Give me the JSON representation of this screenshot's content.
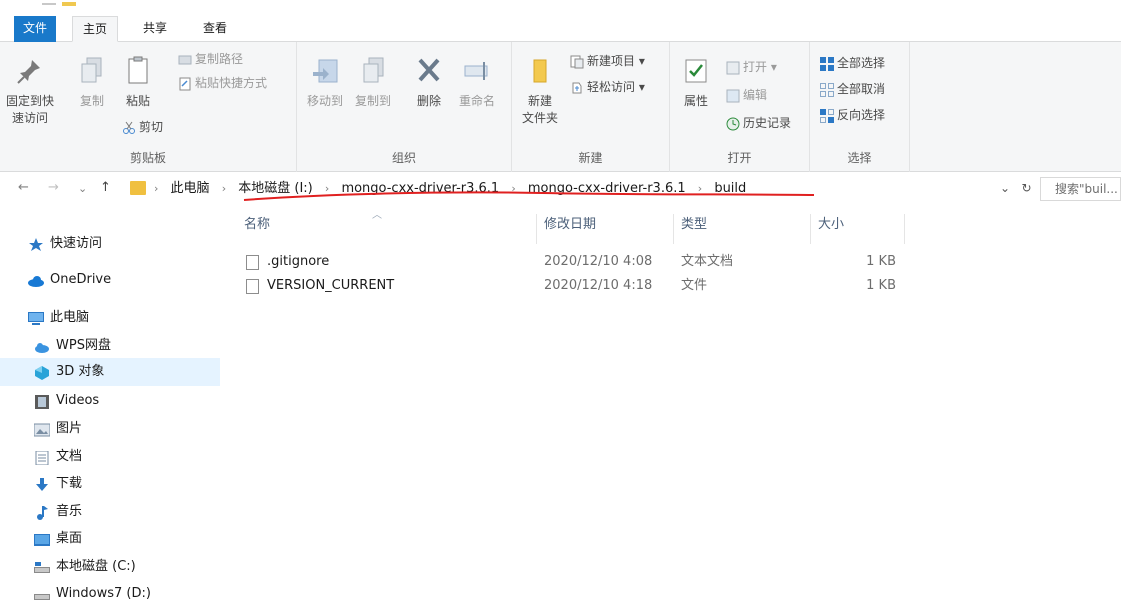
{
  "ribbon_tabs": {
    "file": "文件",
    "home": "主页",
    "share": "共享",
    "view": "查看"
  },
  "clipboard": {
    "pin_label_1": "固定到快",
    "pin_label_2": "速访问",
    "copy": "复制",
    "paste": "粘贴",
    "copy_path": "复制路径",
    "paste_shortcut": "粘贴快捷方式",
    "cut": "剪切",
    "group": "剪贴板"
  },
  "organize": {
    "move_to": "移动到",
    "copy_to": "复制到",
    "delete": "删除",
    "rename": "重命名",
    "group": "组织"
  },
  "new": {
    "new_folder_1": "新建",
    "new_folder_2": "文件夹",
    "new_item": "新建项目 ▾",
    "easy_access": "轻松访问 ▾",
    "group": "新建"
  },
  "open": {
    "properties": "属性",
    "open": "打开 ▾",
    "edit": "编辑",
    "history": "历史记录",
    "group": "打开"
  },
  "select": {
    "select_all": "全部选择",
    "select_none": "全部取消",
    "invert": "反向选择",
    "group": "选择"
  },
  "nav": {
    "back": "←",
    "forward": "→",
    "recent": "⌄",
    "up": "↑"
  },
  "breadcrumb": [
    "此电脑",
    "本地磁盘 (I:)",
    "mongo-cxx-driver-r3.6.1",
    "mongo-cxx-driver-r3.6.1",
    "build"
  ],
  "search": {
    "placeholder": "搜索\"buil..."
  },
  "navpane": [
    {
      "label": "快速访问",
      "icon": "star-icon"
    },
    {
      "label": "OneDrive",
      "icon": "cloud-icon"
    },
    {
      "label": "此电脑",
      "icon": "computer-icon"
    },
    {
      "label": "WPS网盘",
      "icon": "wps-cloud-icon"
    },
    {
      "label": "3D 对象",
      "icon": "cube-icon"
    },
    {
      "label": "Videos",
      "icon": "video-icon"
    },
    {
      "label": "图片",
      "icon": "picture-icon"
    },
    {
      "label": "文档",
      "icon": "document-icon"
    },
    {
      "label": "下载",
      "icon": "download-icon"
    },
    {
      "label": "音乐",
      "icon": "music-icon"
    },
    {
      "label": "桌面",
      "icon": "desktop-icon"
    },
    {
      "label": "本地磁盘 (C:)",
      "icon": "drive-icon"
    },
    {
      "label": "Windows7 (D:)",
      "icon": "drive-icon"
    }
  ],
  "columns": {
    "name": "名称",
    "date": "修改日期",
    "type": "类型",
    "size": "大小"
  },
  "files": [
    {
      "name": ".gitignore",
      "date": "2020/12/10 4:08",
      "type": "文本文档",
      "size": "1 KB"
    },
    {
      "name": "VERSION_CURRENT",
      "date": "2020/12/10 4:18",
      "type": "文件",
      "size": "1 KB"
    }
  ],
  "colors": {
    "accent": "#1979ca",
    "selection": "#e5f3ff",
    "annotation": "#e02020"
  }
}
